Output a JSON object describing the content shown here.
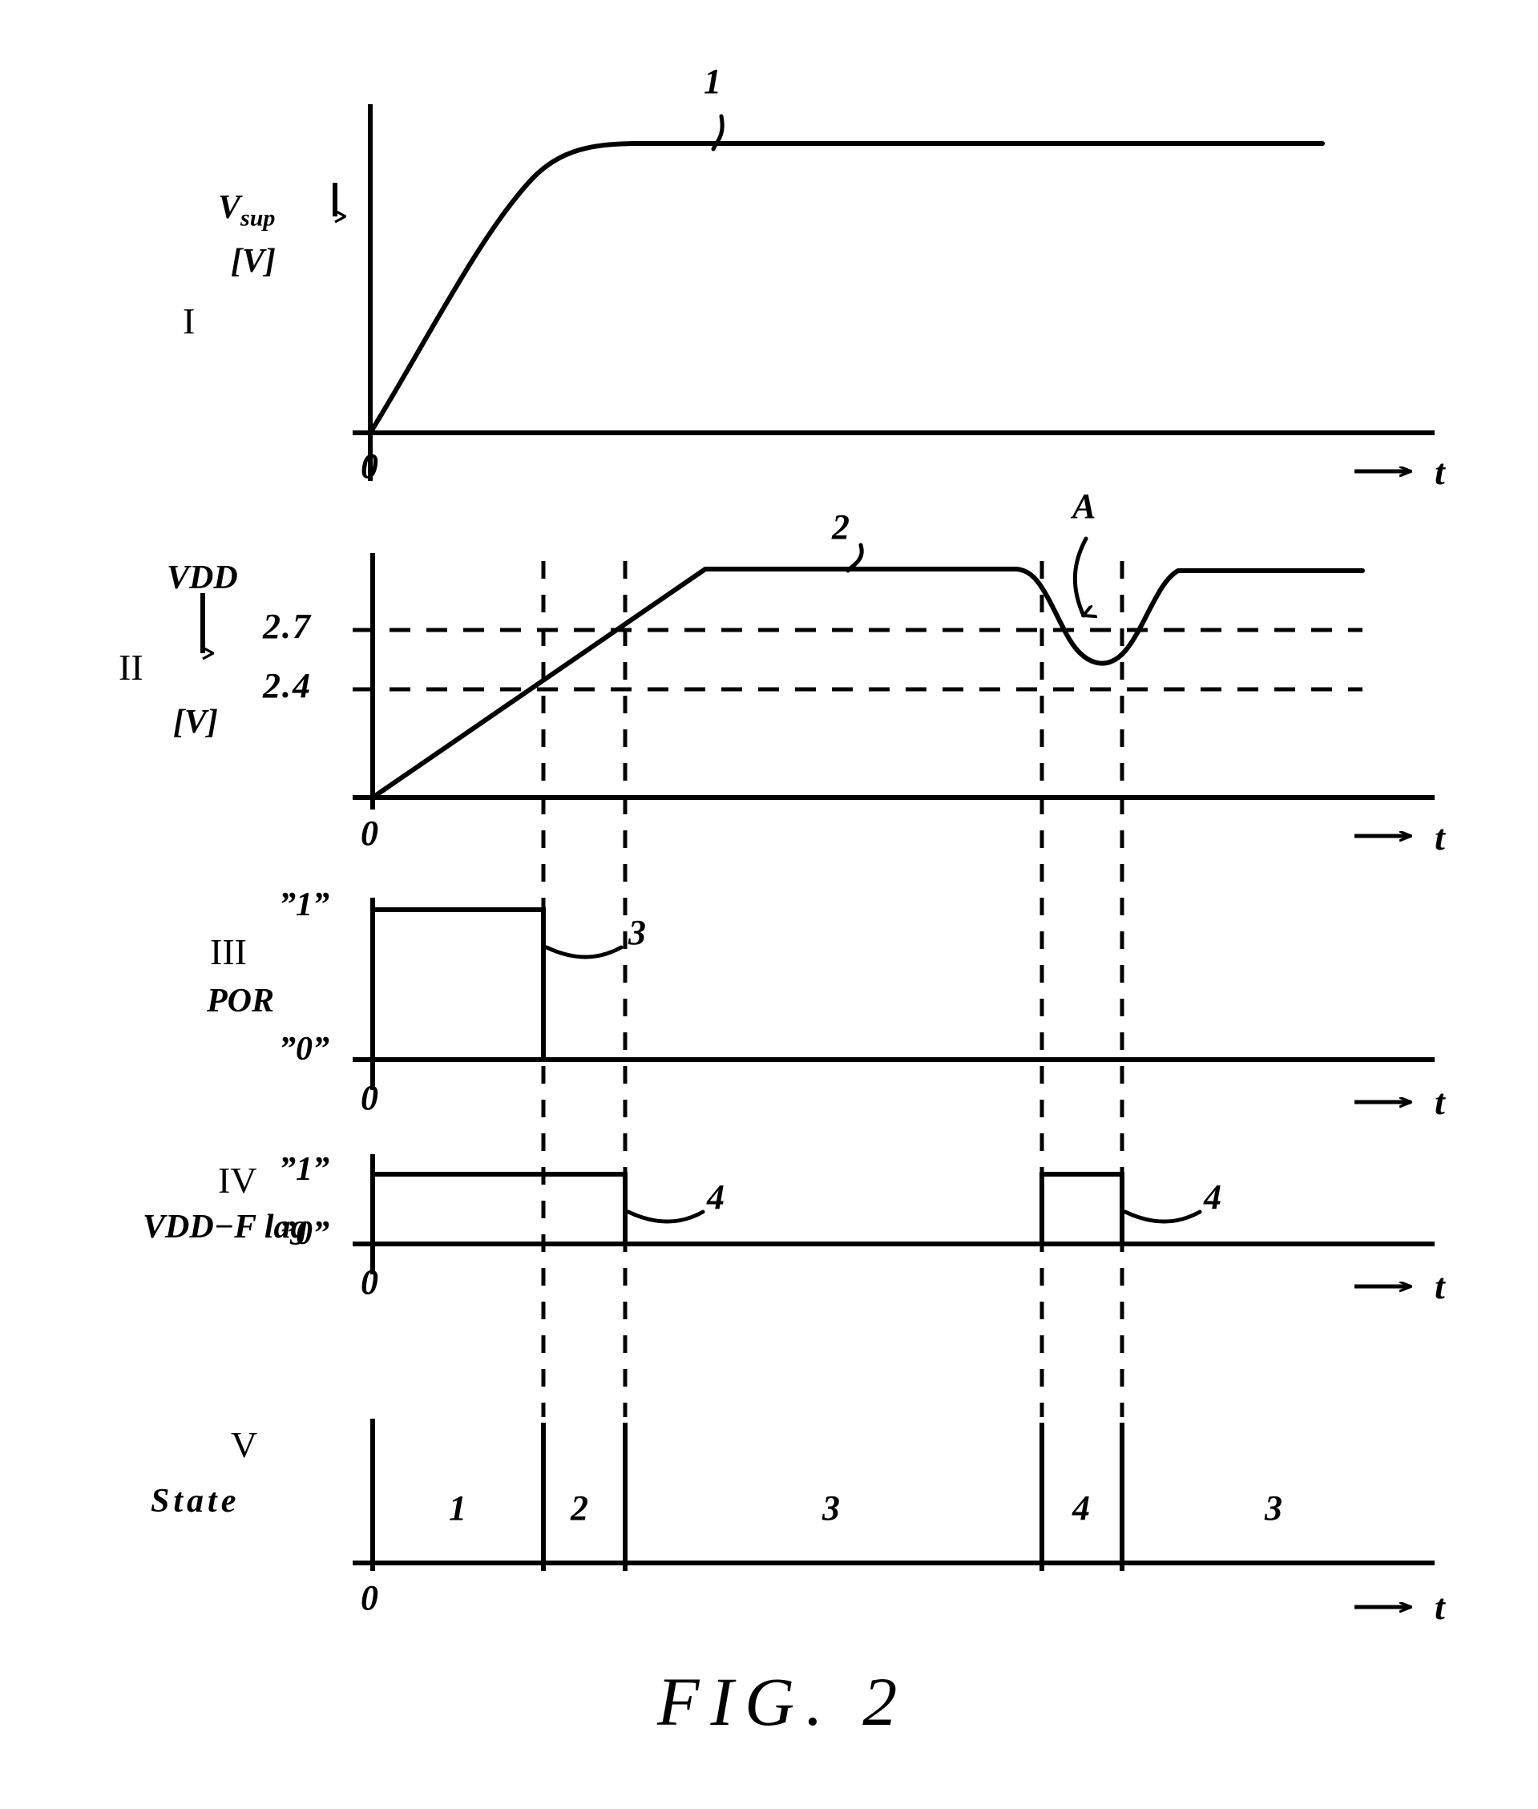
{
  "figure": {
    "caption": "FIG. 2",
    "axis_time_label": "t",
    "origin_label": "0"
  },
  "panels": [
    {
      "roman": "I",
      "signal_name": "V",
      "signal_sub": "sup",
      "unit": "[V]",
      "reference": "1",
      "description": "supply voltage rises then saturates"
    },
    {
      "roman": "II",
      "signal_name": "VDD",
      "unit": "[V]",
      "reference": "2",
      "annotation": "A",
      "thresholds": [
        "2.7",
        "2.4"
      ],
      "description": "internal supply ramps, plateaus, dips, recovers"
    },
    {
      "roman": "III",
      "signal_name": "POR",
      "high_label": "”1”",
      "low_label": "”0”",
      "reference": "3"
    },
    {
      "roman": "IV",
      "signal_name": "VDD−F lag",
      "high_label": "”1”",
      "low_label": "”0”",
      "references": [
        "4",
        "4"
      ]
    },
    {
      "roman": "V",
      "signal_name": "State",
      "states": [
        "1",
        "2",
        "3",
        "4",
        "3"
      ]
    }
  ],
  "chart_data": {
    "type": "line",
    "title": "FIG. 2",
    "xlabel": "t",
    "shared_x_axis": true,
    "event_times": [
      678,
      780,
      1300,
      1400
    ],
    "traces": [
      {
        "panel": "I",
        "name": "V_sup",
        "ylabel": "V_sup [V]",
        "reference": "1",
        "points": [
          [
            455,
            540
          ],
          [
            640,
            240
          ],
          [
            700,
            190
          ],
          [
            780,
            178
          ],
          [
            1640,
            178
          ]
        ],
        "shape": "ramp-then-saturate"
      },
      {
        "panel": "II",
        "name": "VDD",
        "ylabel": "VDD [V]",
        "reference": "2",
        "thresholds": {
          "upper": 2.7,
          "lower": 2.4
        },
        "points": [
          [
            465,
            995
          ],
          [
            880,
            710
          ],
          [
            1270,
            710
          ],
          [
            1310,
            760
          ],
          [
            1345,
            830
          ],
          [
            1395,
            820
          ],
          [
            1440,
            760
          ],
          [
            1470,
            710
          ],
          [
            1700,
            710
          ]
        ],
        "shape": "ramp-plateau-dip-recover",
        "annotation": {
          "label": "A",
          "target": "dip"
        }
      },
      {
        "panel": "III",
        "name": "POR",
        "levels": [
          "”1”",
          "”0”"
        ],
        "reference": "3",
        "transitions": [
          {
            "t": 0,
            "value": 1
          },
          {
            "t": 678,
            "value": 0
          }
        ]
      },
      {
        "panel": "IV",
        "name": "VDD-Flag",
        "levels": [
          "”1”",
          "”0”"
        ],
        "references": [
          "4",
          "4"
        ],
        "transitions": [
          {
            "t": 0,
            "value": 1
          },
          {
            "t": 780,
            "value": 0
          },
          {
            "t": 1300,
            "value": 1
          },
          {
            "t": 1400,
            "value": 0
          }
        ]
      },
      {
        "panel": "V",
        "name": "State",
        "segments": [
          {
            "label": "1",
            "start": 465,
            "end": 678
          },
          {
            "label": "2",
            "start": 678,
            "end": 780
          },
          {
            "label": "3",
            "start": 780,
            "end": 1300
          },
          {
            "label": "4",
            "start": 1300,
            "end": 1400
          },
          {
            "label": "3",
            "start": 1400,
            "end": 1700
          }
        ]
      }
    ]
  }
}
